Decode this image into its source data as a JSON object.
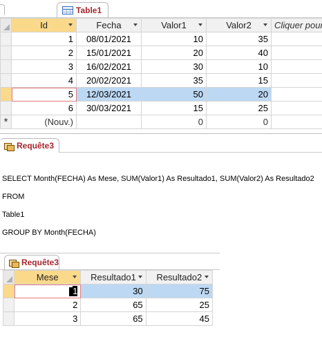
{
  "table_tab": {
    "title": "Table1",
    "icon": "table-icon"
  },
  "table": {
    "columns": [
      "Id",
      "Fecha",
      "Valor1",
      "Valor2",
      "Cliquer pour"
    ],
    "rows": [
      {
        "id": "1",
        "fecha": "08/01/2021",
        "valor1": "10",
        "valor2": "35"
      },
      {
        "id": "2",
        "fecha": "15/01/2021",
        "valor1": "20",
        "valor2": "40"
      },
      {
        "id": "3",
        "fecha": "16/02/2021",
        "valor1": "30",
        "valor2": "10"
      },
      {
        "id": "4",
        "fecha": "20/02/2021",
        "valor1": "35",
        "valor2": "15"
      },
      {
        "id": "5",
        "fecha": "12/03/2021",
        "valor1": "50",
        "valor2": "20"
      },
      {
        "id": "6",
        "fecha": "30/03/2021",
        "valor1": "15",
        "valor2": "25"
      }
    ],
    "new_row": {
      "marker": "*",
      "id": "(Nouv.)",
      "valor1": "0",
      "valor2": "0"
    },
    "selected_row": "5"
  },
  "query_tab": {
    "title": "Requête3",
    "icon": "query-icon"
  },
  "sql": {
    "line1": "SELECT Month(FECHA) As Mese, SUM(Valor1) As Resultado1, SUM(Valor2) As Resultado2",
    "line2": "FROM",
    "line3": "Table1",
    "line4": "GROUP BY  Month(FECHA)"
  },
  "result_tab": {
    "title": "Requête3",
    "icon": "query-icon"
  },
  "result": {
    "columns": [
      "Mese",
      "Resultado1",
      "Resultado2"
    ],
    "rows": [
      {
        "mese": "1",
        "r1": "30",
        "r2": "75"
      },
      {
        "mese": "2",
        "r1": "65",
        "r2": "25"
      },
      {
        "mese": "3",
        "r1": "65",
        "r2": "45"
      }
    ]
  }
}
